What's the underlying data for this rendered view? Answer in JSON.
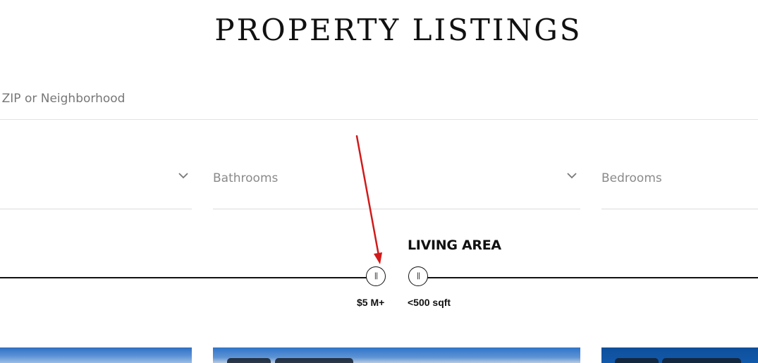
{
  "header": {
    "title": "PROPERTY LISTINGS"
  },
  "search": {
    "placeholder": "City, Address, ZIP or Neighborhood"
  },
  "filters": {
    "selects": [
      {
        "label": ""
      },
      {
        "label": "Bathrooms"
      },
      {
        "label": "Bedrooms"
      }
    ],
    "price": {
      "value_label": "$5 M+",
      "level": 1.0
    },
    "living_area": {
      "heading": "LIVING AREA",
      "value_label": "<500 sqft",
      "level": 0.0
    }
  },
  "annotation": {
    "color": "#d11a1a"
  },
  "icons": {
    "chevron": "chevron-down-icon",
    "grip": "grip-icon",
    "arrow": "arrow-annotation"
  }
}
